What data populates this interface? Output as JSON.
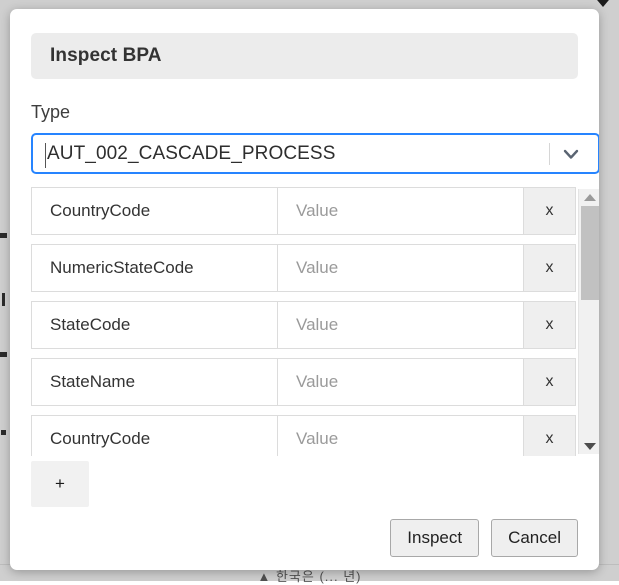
{
  "dialog": {
    "title": "Inspect BPA",
    "type_label": "Type",
    "select": {
      "value": "AUT_002_CASCADE_PROCESS",
      "arrow_icon": "chevron-down-icon"
    },
    "rows": [
      {
        "key": "CountryCode",
        "value_placeholder": "Value",
        "delete_label": "x"
      },
      {
        "key": "NumericStateCode",
        "value_placeholder": "Value",
        "delete_label": "x"
      },
      {
        "key": "StateCode",
        "value_placeholder": "Value",
        "delete_label": "x"
      },
      {
        "key": "StateName",
        "value_placeholder": "Value",
        "delete_label": "x"
      },
      {
        "key": "CountryCode",
        "value_placeholder": "Value",
        "delete_label": "x"
      }
    ],
    "add_label": "+",
    "buttons": {
      "primary": "Inspect",
      "secondary": "Cancel"
    },
    "scrollbar": {
      "up_icon": "triangle-up-icon",
      "down_icon": "triangle-down-icon"
    }
  },
  "background": {
    "bottom_text": "▲ 한국은 (... 년)",
    "top_caret_icon": "caret-down-icon"
  },
  "colors": {
    "accent": "#2684ff",
    "header_bg": "#ececec",
    "dialog_bg": "#ffffff",
    "page_bg": "#cfcfcf",
    "button_bg": "#efefef",
    "scroll_thumb": "#c1c1c1"
  }
}
